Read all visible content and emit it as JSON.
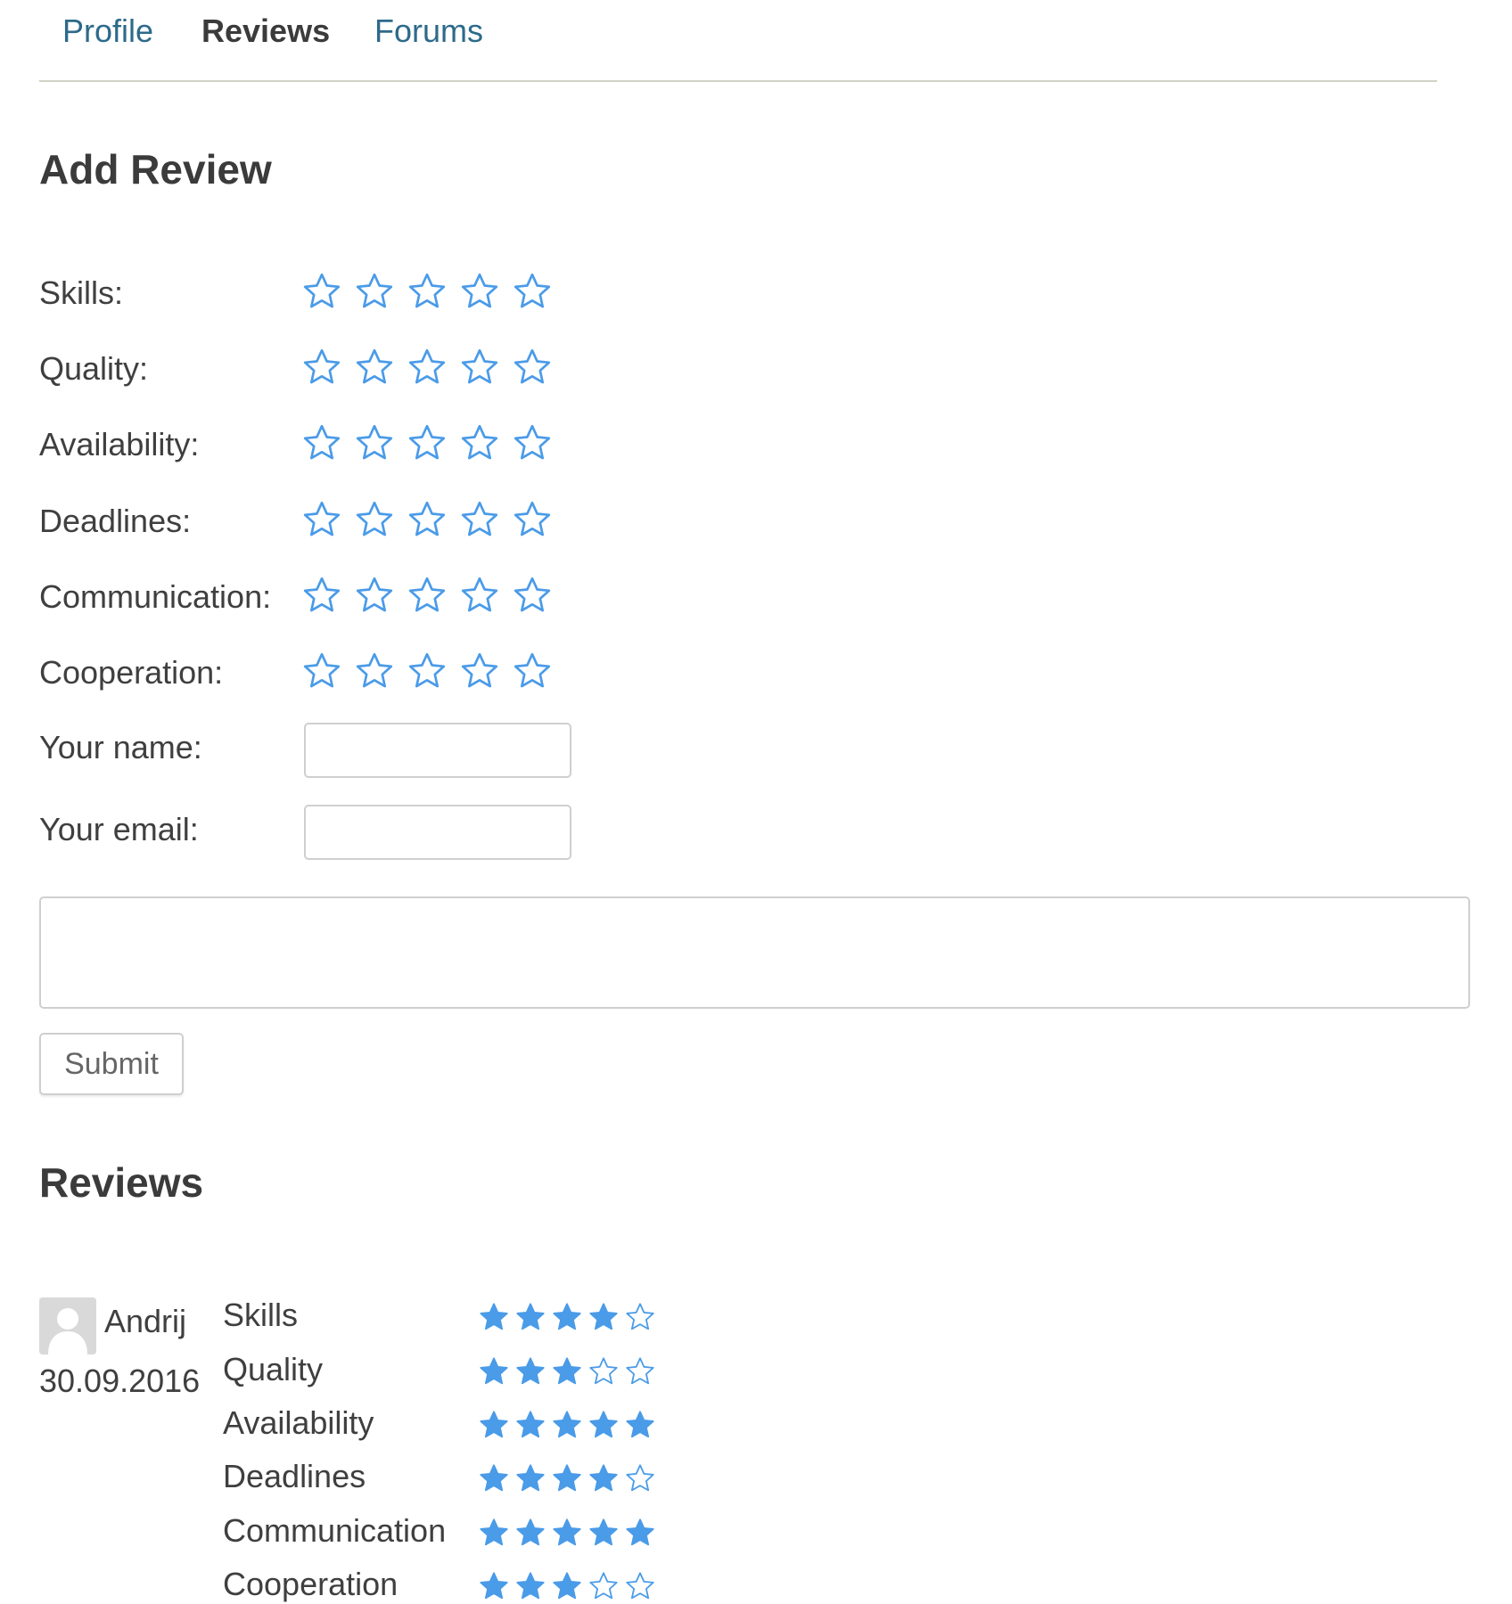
{
  "tabs": [
    {
      "label": "Profile",
      "active": false
    },
    {
      "label": "Reviews",
      "active": true
    },
    {
      "label": "Forums",
      "active": false
    }
  ],
  "add_review": {
    "title": "Add Review",
    "criteria": [
      {
        "label": "Skills:",
        "rating": 0,
        "max": 5
      },
      {
        "label": "Quality:",
        "rating": 0,
        "max": 5
      },
      {
        "label": "Availability:",
        "rating": 0,
        "max": 5
      },
      {
        "label": "Deadlines:",
        "rating": 0,
        "max": 5
      },
      {
        "label": "Communication:",
        "rating": 0,
        "max": 5
      },
      {
        "label": "Cooperation:",
        "rating": 0,
        "max": 5
      }
    ],
    "name_label": "Your name:",
    "name_value": "",
    "email_label": "Your email:",
    "email_value": "",
    "comment_value": "",
    "submit_label": "Submit"
  },
  "reviews": {
    "title": "Reviews",
    "items": [
      {
        "author": "Andrij",
        "date": "30.09.2016",
        "ratings": [
          {
            "label": "Skills",
            "value": 4
          },
          {
            "label": "Quality",
            "value": 3
          },
          {
            "label": "Availability",
            "value": 5
          },
          {
            "label": "Deadlines",
            "value": 4
          },
          {
            "label": "Communication",
            "value": 5
          },
          {
            "label": "Cooperation",
            "value": 3
          }
        ]
      }
    ]
  },
  "icons": {
    "star_empty": "star-outline-icon",
    "star_filled": "star-filled-icon",
    "avatar": "user-silhouette-icon"
  },
  "colors": {
    "star": "#4a9be8",
    "link": "#2d6a8a",
    "text": "#3b3b3b",
    "divider": "#d2d2c8"
  }
}
